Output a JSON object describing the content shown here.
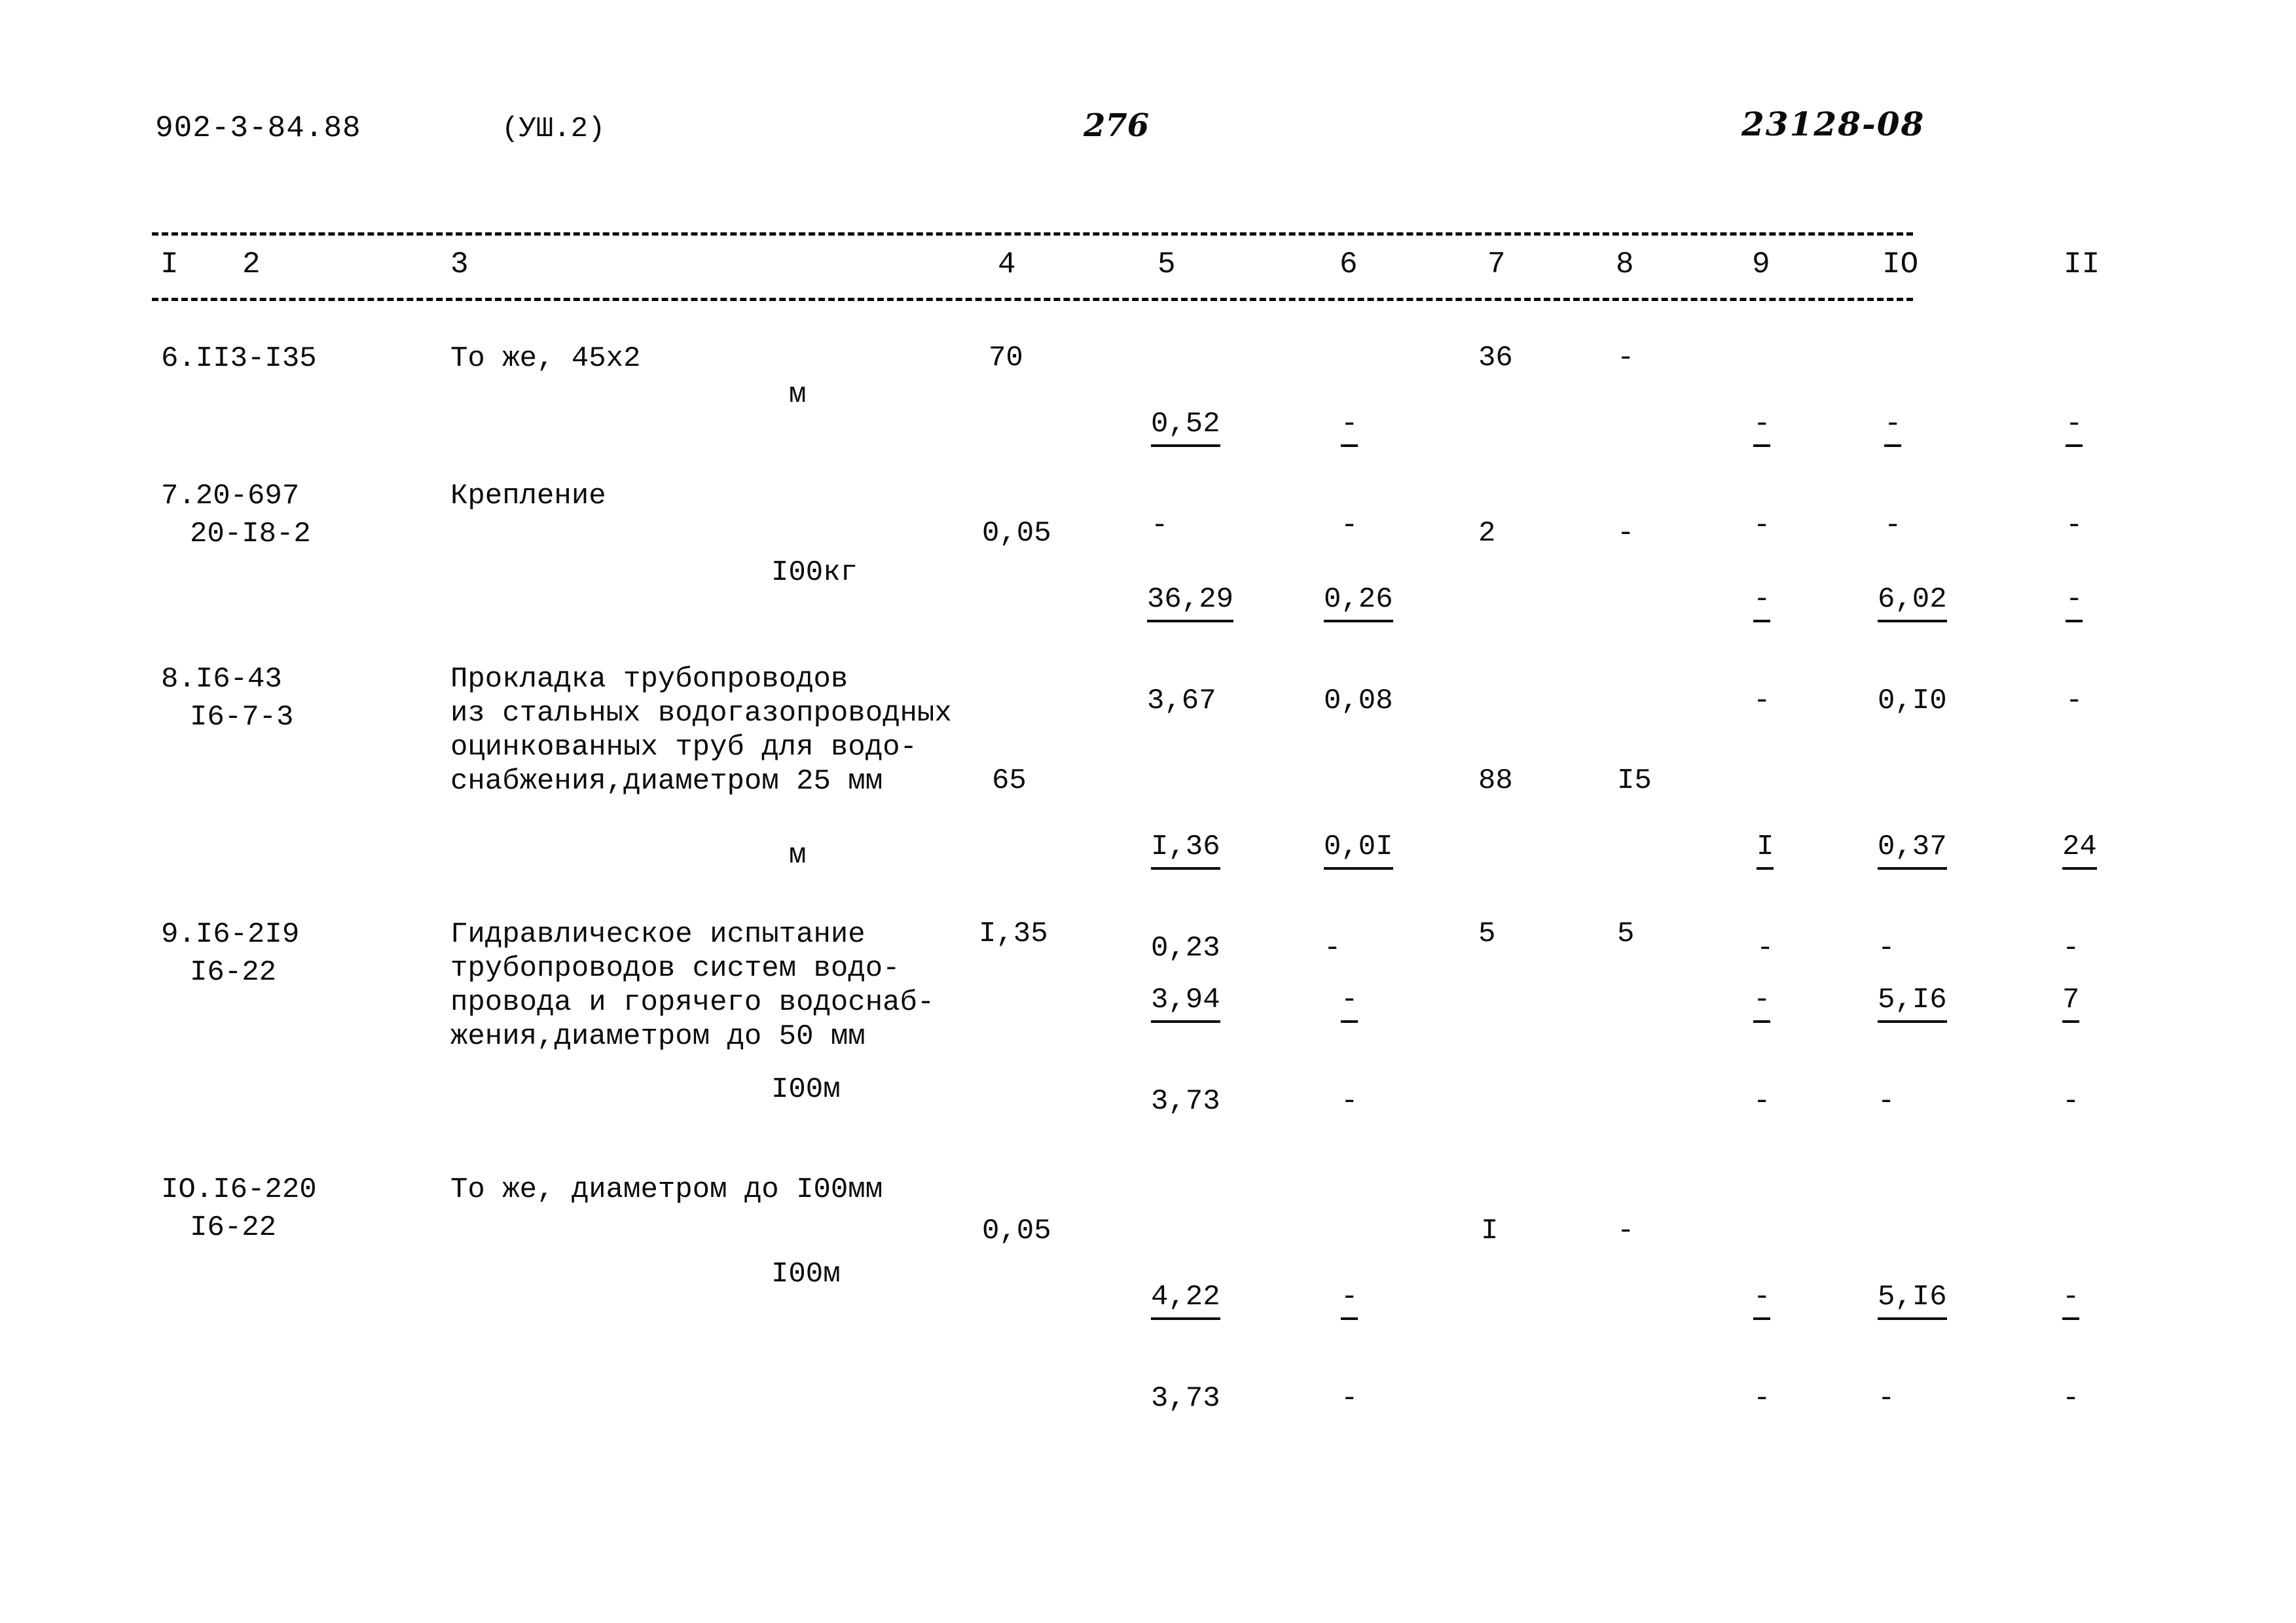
{
  "header": {
    "doc_code": "902-3-84.88",
    "series": "(УШ.2)",
    "page_number": "276",
    "ref_number": "23128-08"
  },
  "table": {
    "column_headers": [
      "I",
      "2",
      "3",
      "4",
      "5",
      "6",
      "7",
      "8",
      "9",
      "IO",
      "II"
    ],
    "rows": [
      {
        "code_line1": "6.II3-I35",
        "code_line2": "",
        "desc_line1": "То же, 45х2",
        "desc_line2": "",
        "desc_line3": "",
        "desc_line4": "",
        "unit": "м",
        "c4": "70",
        "c5a": "0,52",
        "c5b": "-",
        "c6a": "-",
        "c6b": "-",
        "c7": "36",
        "c8": "-",
        "c9a": "-",
        "c9b": "-",
        "c10a": "-",
        "c10b": "-",
        "c11a": "-",
        "c11b": "-"
      },
      {
        "code_line1": "7.20-697",
        "code_line2": "20-I8-2",
        "desc_line1": "Крепление",
        "desc_line2": "",
        "desc_line3": "",
        "desc_line4": "",
        "unit": "I00кг",
        "c4": "0,05",
        "c5a": "36,29",
        "c5b": "3,67",
        "c6a": "0,26",
        "c6b": "0,08",
        "c7": "2",
        "c8": "-",
        "c9a": "-",
        "c9b": "-",
        "c10a": "6,02",
        "c10b": "0,I0",
        "c11a": "-",
        "c11b": "-"
      },
      {
        "code_line1": "8.I6-43",
        "code_line2": "I6-7-3",
        "desc_line1": "Прокладка трубопроводов",
        "desc_line2": "из стальных водогазопроводных",
        "desc_line3": "оцинкованных труб для водо-",
        "desc_line4": "снабжения,диаметром 25 мм",
        "unit": "м",
        "c4": "65",
        "c5a": "I,36",
        "c5b": "0,23",
        "c6a": "0,0I",
        "c6b": "-",
        "c7": "88",
        "c8": "I5",
        "c9a": "I",
        "c9b": "-",
        "c10a": "0,37",
        "c10b": "-",
        "c11a": "24",
        "c11b": "-"
      },
      {
        "code_line1": "9.I6-2I9",
        "code_line2": "I6-22",
        "desc_line1": "Гидравлическое испытание",
        "desc_line2": "трубопроводов систем водо-",
        "desc_line3": "провода и горячего водоснаб-",
        "desc_line4": "жения,диаметром до 50 мм",
        "unit": "I00м",
        "c4": "I,35",
        "c5a": "3,94",
        "c5b": "3,73",
        "c6a": "-",
        "c6b": "-",
        "c7": "5",
        "c8": "5",
        "c9a": "-",
        "c9b": "-",
        "c10a": "5,I6",
        "c10b": "-",
        "c11a": "7",
        "c11b": "-"
      },
      {
        "code_line1": "IO.I6-220",
        "code_line2": "I6-22",
        "desc_line1": "То же, диаметром до I00мм",
        "desc_line2": "",
        "desc_line3": "",
        "desc_line4": "",
        "unit": "I00м",
        "c4": "0,05",
        "c5a": "4,22",
        "c5b": "3,73",
        "c6a": "-",
        "c6b": "-",
        "c7": "I",
        "c8": "-",
        "c9a": "-",
        "c9b": "-",
        "c10a": "5,I6",
        "c10b": "-",
        "c11a": "-",
        "c11b": "-"
      }
    ]
  }
}
